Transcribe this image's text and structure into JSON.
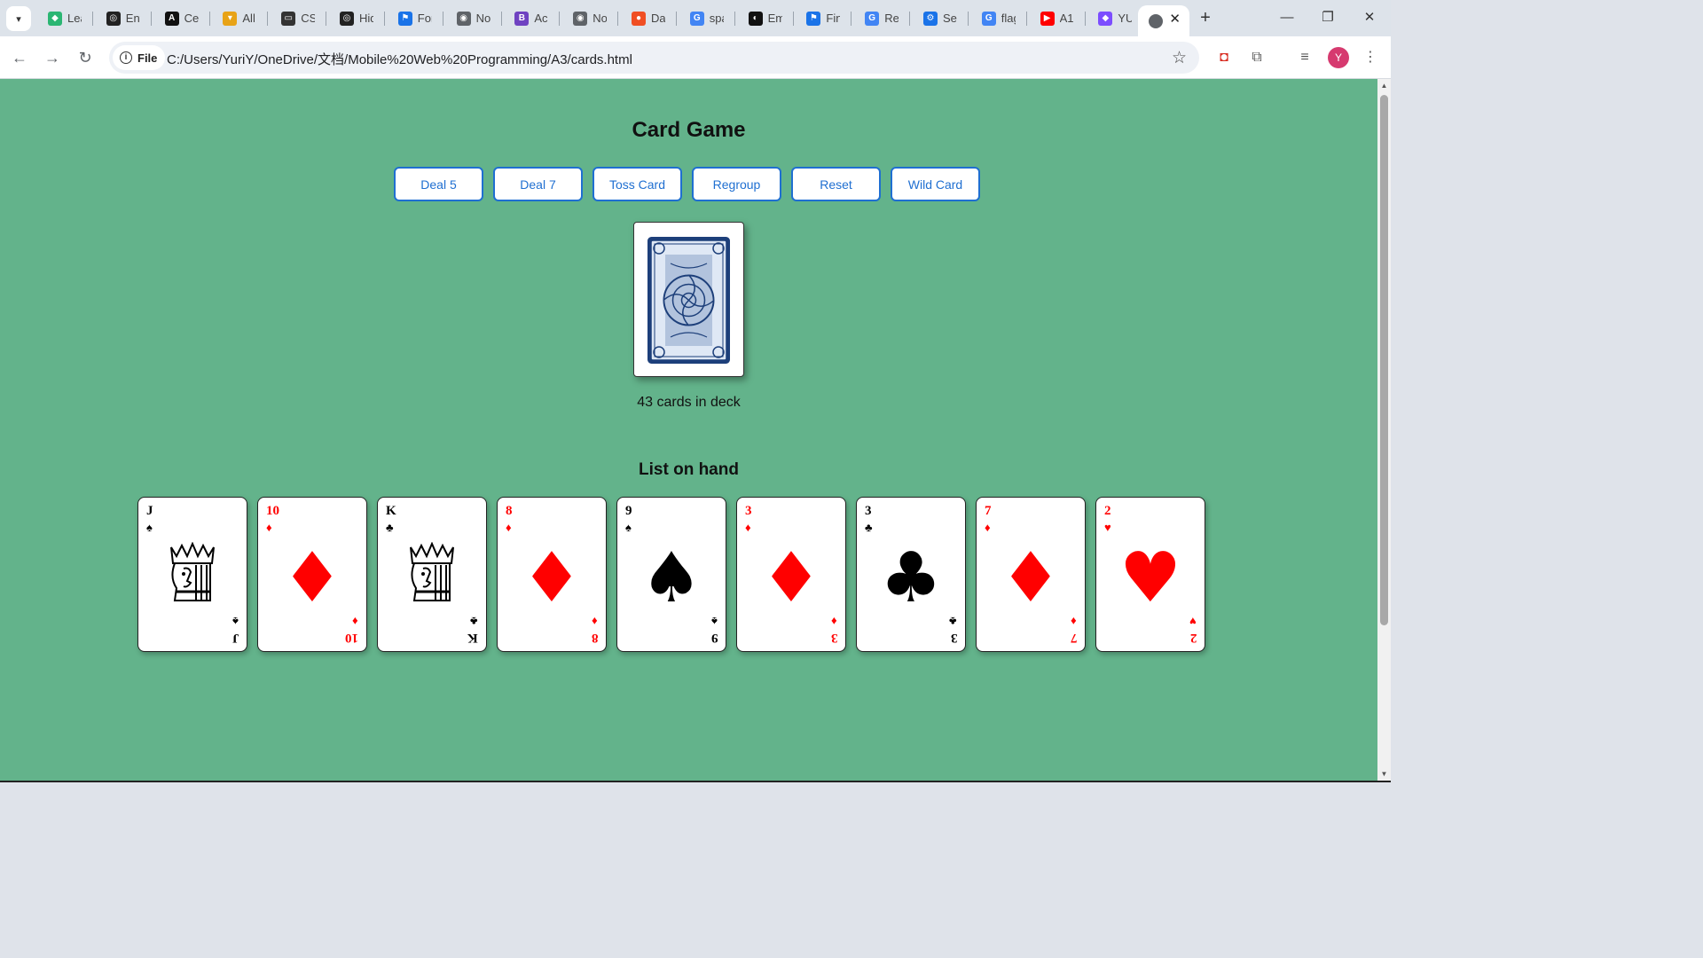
{
  "browser": {
    "tabs": [
      {
        "label": "Lea",
        "color": "#2bb673",
        "glyph": "◆"
      },
      {
        "label": "Ent",
        "color": "#222222",
        "glyph": "◎"
      },
      {
        "label": "Cer",
        "color": "#111111",
        "glyph": "A"
      },
      {
        "label": "All",
        "color": "#e8a317",
        "glyph": "▾"
      },
      {
        "label": "CSS",
        "color": "#333333",
        "glyph": "▭"
      },
      {
        "label": "Hid",
        "color": "#222222",
        "glyph": "◎"
      },
      {
        "label": "For",
        "color": "#1a73e8",
        "glyph": "⚑"
      },
      {
        "label": "No",
        "color": "#5f6368",
        "glyph": "◉"
      },
      {
        "label": "Acc",
        "color": "#6f42c1",
        "glyph": "B"
      },
      {
        "label": "No",
        "color": "#5f6368",
        "glyph": "◉"
      },
      {
        "label": "Das",
        "color": "#f04e23",
        "glyph": "●"
      },
      {
        "label": "spa",
        "color": "#4285f4",
        "glyph": "G"
      },
      {
        "label": "Em",
        "color": "#111111",
        "glyph": "◐"
      },
      {
        "label": "Fin",
        "color": "#1a73e8",
        "glyph": "⚑"
      },
      {
        "label": "Rea",
        "color": "#4285f4",
        "glyph": "G"
      },
      {
        "label": "Set",
        "color": "#1a73e8",
        "glyph": "⚙"
      },
      {
        "label": "flag",
        "color": "#4285f4",
        "glyph": "G"
      },
      {
        "label": "A1",
        "color": "#ff0000",
        "glyph": "▶"
      },
      {
        "label": "YU",
        "color": "#7c4dff",
        "glyph": "◆"
      }
    ],
    "active_tab_label": "",
    "close_glyph": "✕",
    "new_tab_glyph": "+",
    "chip_label": "File",
    "url": "C:/Users/YuriY/OneDrive/文档/Mobile%20Web%20Programming/A3/cards.html",
    "profile_initial": "Y"
  },
  "page": {
    "title": "Card Game",
    "buttons": [
      "Deal 5",
      "Deal 7",
      "Toss Card",
      "Regroup",
      "Reset",
      "Wild Card"
    ],
    "deck_count_text": "43 cards in deck",
    "hand_title": "List on hand"
  },
  "hand": [
    {
      "rank": "J",
      "suit": "♠",
      "color": "black",
      "face": true
    },
    {
      "rank": "10",
      "suit": "♦",
      "color": "red",
      "face": false
    },
    {
      "rank": "K",
      "suit": "♣",
      "color": "black",
      "face": true
    },
    {
      "rank": "8",
      "suit": "♦",
      "color": "red",
      "face": false
    },
    {
      "rank": "9",
      "suit": "♠",
      "color": "black",
      "face": false
    },
    {
      "rank": "3",
      "suit": "♦",
      "color": "red",
      "face": false
    },
    {
      "rank": "3",
      "suit": "♣",
      "color": "black",
      "face": false
    },
    {
      "rank": "7",
      "suit": "♦",
      "color": "red",
      "face": false
    },
    {
      "rank": "2",
      "suit": "♥",
      "color": "red",
      "face": false
    }
  ],
  "colors": {
    "page_bg": "#63b38b",
    "button_accent": "#1f6fd1",
    "card_red": "#ff0000",
    "deck_back": "#1d3f7a"
  }
}
